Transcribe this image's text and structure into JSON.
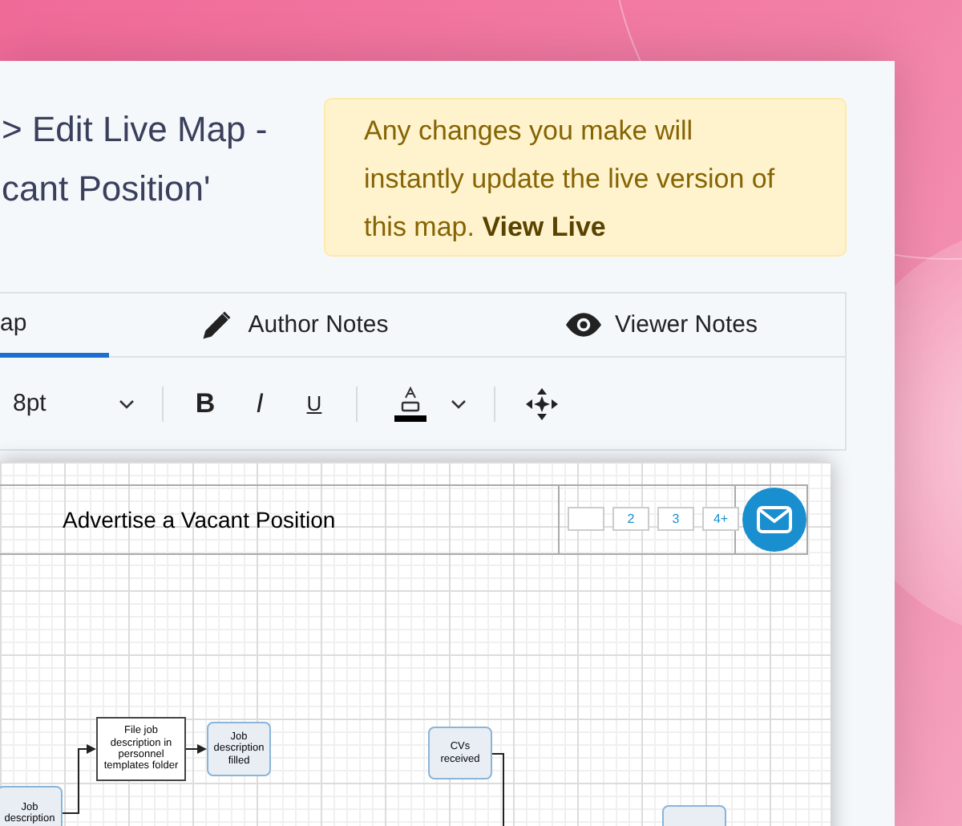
{
  "title_lines": [
    "> Edit Live Map -",
    "cant Position'"
  ],
  "notice": {
    "text": "Any changes you make will instantly update the live version of this map.",
    "link": "View Live"
  },
  "tabs": [
    {
      "label": "ap",
      "selected": true
    },
    {
      "label": "Author Notes",
      "selected": false
    },
    {
      "label": "Viewer Notes",
      "selected": false
    }
  ],
  "toolbar": [
    {
      "kind": "select",
      "value": "8pt"
    },
    {
      "kind": "separator"
    },
    {
      "kind": "bold",
      "label": "B"
    },
    {
      "kind": "italic",
      "label": "I"
    },
    {
      "kind": "underline",
      "label": "U"
    },
    {
      "kind": "separator"
    },
    {
      "kind": "color"
    },
    {
      "kind": "separator"
    },
    {
      "kind": "move"
    }
  ],
  "map": {
    "title": "Advertise a Vacant Position",
    "pages": [
      "2",
      "3",
      "4+"
    ],
    "nodes": [
      {
        "text": "File job description in personnel templates folder",
        "kind": "task"
      },
      {
        "text": "Job description filled",
        "kind": "event"
      },
      {
        "text": "CVs received",
        "kind": "event"
      },
      {
        "text": "Job description",
        "kind": "event"
      },
      {
        "kind": "event"
      }
    ]
  }
}
